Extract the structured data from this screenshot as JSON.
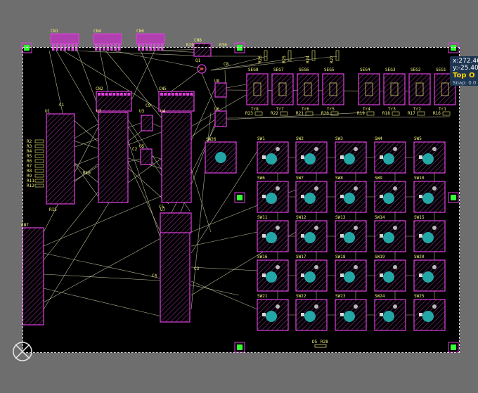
{
  "colors": {
    "background": "#6e6e6e",
    "board": "#000000",
    "component_outline": "#e040e0",
    "hatch": "#7a2a7a",
    "silkscreen": "#f2f27a",
    "ratsnest": "#d8d8b0",
    "pad": "#22a6a6",
    "fiducial": "#33ff33",
    "readout_bg": "#1d3550"
  },
  "readout": {
    "x": "x:272.46",
    "y": "y:-25.400",
    "layer": "Top O",
    "snap": "Snap: 0.0"
  },
  "connectors": [
    "CN1",
    "CN4",
    "CN6",
    "CN2",
    "CN5",
    "CN7"
  ],
  "ics": [
    "U1",
    "U2",
    "U3",
    "U4",
    "U5",
    "U6",
    "U7",
    "U8"
  ],
  "segments": [
    "SEG8",
    "SEG7",
    "SEG6",
    "SEG5",
    "SEG4",
    "SEG3",
    "SEG2",
    "SEG1"
  ],
  "switches": [
    "SW1",
    "SW2",
    "SW3",
    "SW4",
    "SW5",
    "SW6",
    "SW7",
    "SW8",
    "SW9",
    "SW10",
    "SW11",
    "SW12",
    "SW13",
    "SW14",
    "SW15",
    "SW16",
    "SW17",
    "SW18",
    "SW19",
    "SW20",
    "SW21",
    "SW22",
    "SW23",
    "SW24",
    "SW25"
  ],
  "labels": {
    "sw26": "SW26",
    "cn8": "CN8",
    "q1": "Q1",
    "c8": "C8",
    "c1": "C1",
    "c2": "C2",
    "c3": "C3",
    "c4": "C4",
    "c5": "C5",
    "c9": "C9",
    "r15": "R15",
    "r29": "R29",
    "r30": "R30",
    "ds": "D5",
    "r28": "R28",
    "r10": "R10",
    "r_left": [
      "R2",
      "R3",
      "R4",
      "R5",
      "R6",
      "R7",
      "R8",
      "R9",
      "R11",
      "R12"
    ],
    "r_row": [
      "R23",
      "R22",
      "R21",
      "R20",
      "R19",
      "R18",
      "R17",
      "R16"
    ],
    "tr_row": [
      "Tr8",
      "Tr7",
      "Tr6",
      "Tr5",
      "Tr4",
      "Tr3",
      "Tr2",
      "Tr1"
    ],
    "top_r": [
      "R26",
      "R25",
      "R24",
      "R27"
    ]
  }
}
